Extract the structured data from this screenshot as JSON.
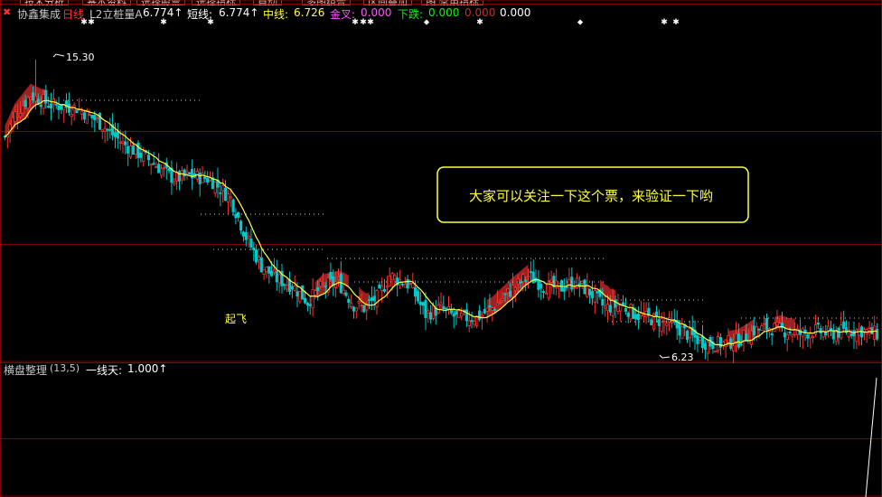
{
  "toolbar": {
    "buttons": [
      "技术分析",
      "基本资料",
      "选择股票",
      "选择指标",
      "自动",
      "多图组合",
      "区间叠加",
      "图",
      "常用指标"
    ]
  },
  "header": {
    "stock_name": "协鑫集成",
    "period": "日线",
    "indicator_name": "L2立桩量A",
    "indicator_value": "6.774↑",
    "short_label": "短线:",
    "short_value": "6.774↑",
    "mid_label": "中线:",
    "mid_value": "6.726",
    "golden_label": "金叉:",
    "golden_value": "0.000",
    "down_label": "下跌:",
    "down_value": "0.000",
    "red_value": "0.000",
    "last_value": "0.000"
  },
  "lower_panel": {
    "indicator_name": "横盘整理",
    "params": "(13,5)",
    "line_label": "一线天:",
    "line_value": "1.000↑"
  },
  "annotations": {
    "high_label": "15.30",
    "low_label": "6.23",
    "takeoff_label": "起飞",
    "callout_text": "大家可以关注一下这个票，来验证一下哟"
  },
  "colors": {
    "up": "#ff3232",
    "down": "#00c8c8",
    "ma": "#ffff40",
    "red_fill": "#b22222",
    "grid": "#800000",
    "white": "#ffffff",
    "green_text": "#00ff00",
    "magenta_text": "#ff55ff",
    "yellow_text": "#ffff00"
  },
  "chart_data": {
    "type": "candlestick",
    "ylim": [
      6.0,
      16.5
    ],
    "price_high": 15.3,
    "price_low": 6.23,
    "close_anchors": [
      [
        0,
        12.9
      ],
      [
        4,
        13.6
      ],
      [
        10,
        14.2
      ],
      [
        18,
        13.9
      ],
      [
        28,
        13.8
      ],
      [
        36,
        13.4
      ],
      [
        46,
        12.7
      ],
      [
        56,
        12.2
      ],
      [
        66,
        11.6
      ],
      [
        72,
        11.7
      ],
      [
        80,
        11.6
      ],
      [
        88,
        11.0
      ],
      [
        94,
        9.8
      ],
      [
        100,
        8.9
      ],
      [
        106,
        8.5
      ],
      [
        112,
        8.3
      ],
      [
        118,
        7.8
      ],
      [
        124,
        8.3
      ],
      [
        130,
        8.4
      ],
      [
        136,
        7.7
      ],
      [
        140,
        7.6
      ],
      [
        146,
        8.0
      ],
      [
        150,
        8.6
      ],
      [
        158,
        8.3
      ],
      [
        164,
        7.4
      ],
      [
        170,
        7.6
      ],
      [
        176,
        7.3
      ],
      [
        184,
        7.3
      ],
      [
        190,
        7.6
      ],
      [
        198,
        8.2
      ],
      [
        204,
        8.6
      ],
      [
        210,
        8.3
      ],
      [
        216,
        8.2
      ],
      [
        222,
        8.4
      ],
      [
        228,
        8.1
      ],
      [
        234,
        7.6
      ],
      [
        240,
        7.7
      ],
      [
        246,
        7.4
      ],
      [
        250,
        7.3
      ],
      [
        256,
        7.2
      ],
      [
        262,
        7.0
      ],
      [
        268,
        6.7
      ],
      [
        274,
        6.5
      ],
      [
        280,
        6.5
      ],
      [
        286,
        6.6
      ],
      [
        292,
        6.9
      ],
      [
        298,
        7.0
      ],
      [
        304,
        6.9
      ],
      [
        310,
        6.8
      ],
      [
        316,
        6.9
      ],
      [
        322,
        6.8
      ],
      [
        328,
        6.9
      ],
      [
        334,
        6.9
      ],
      [
        340,
        6.8
      ]
    ],
    "ma_label": "mid line",
    "signals": {
      "white_stars_top_x": [
        93,
        101,
        181,
        233,
        393,
        402,
        410,
        531,
        735,
        748
      ],
      "diamonds_top_x": [
        472,
        642
      ]
    }
  }
}
